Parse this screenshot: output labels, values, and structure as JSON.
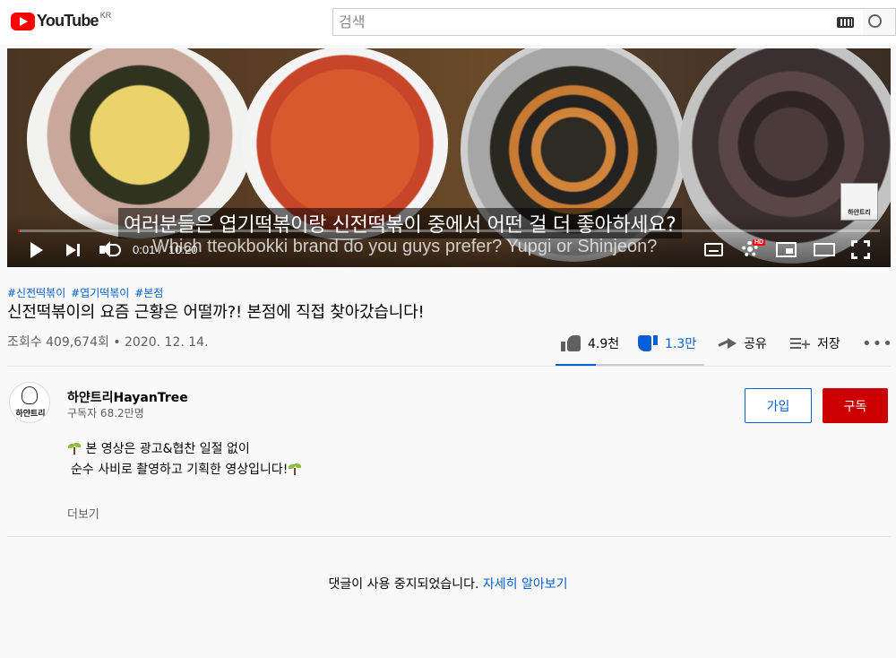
{
  "masthead": {
    "logo_text": "YouTube",
    "region": "KR",
    "search_placeholder": "검색"
  },
  "player": {
    "subtitle_ko": "여러분들은 엽기떡볶이랑 신전떡볶이 중에서 어떤 걸 더 좋아하세요?",
    "subtitle_en": "Which tteokbokki brand do you guys prefer? Yupgi or Shinjeon?",
    "time_current": "0:01",
    "time_total": "10:20",
    "hd_badge": "HD",
    "watermark_text": "하얀트리",
    "progress_fraction": 0.0016
  },
  "video": {
    "hashtags": [
      "#신전떡볶이",
      "#엽기떡볶이",
      "#본점"
    ],
    "title": "신전떡볶이의 요즘 근황은 어떨까?! 본점에 직접 찾아갔습니다!",
    "views_and_date": "조회수 409,674회 • 2020. 12. 14.",
    "like_count": "4.9천",
    "dislike_count": "1.3만",
    "share_label": "공유",
    "save_label": "저장",
    "like_ratio": 0.27
  },
  "channel": {
    "name": "하얀트리HayanTree",
    "subscribers": "구독자 68.2만명",
    "avatar_text": "하얀트리",
    "join_label": "가입",
    "subscribe_label": "구독"
  },
  "description": {
    "line1": "본 영상은 광고&협찬 일절 없이",
    "line2": "순수 사비로 촬영하고 기획한 영상입니다!",
    "show_more": "더보기"
  },
  "comments": {
    "disabled_text": "댓글이 사용 중지되었습니다.",
    "learn_more": "자세히 알아보기"
  },
  "colors": {
    "accent_blue": "#065fd4",
    "subscribe_red": "#cc0000",
    "youtube_red": "#ff0000"
  }
}
